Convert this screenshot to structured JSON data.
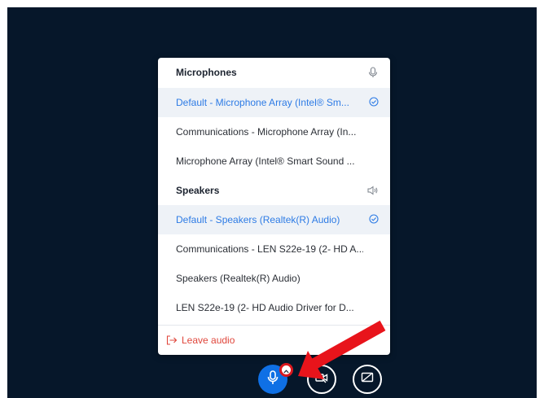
{
  "microphones": {
    "title": "Microphones",
    "header_icon": "microphone-icon",
    "items": [
      {
        "label": "Default - Microphone Array (Intel® Sm...",
        "selected": true
      },
      {
        "label": "Communications - Microphone Array (In...",
        "selected": false
      },
      {
        "label": "Microphone Array (Intel® Smart Sound ...",
        "selected": false
      }
    ]
  },
  "speakers": {
    "title": "Speakers",
    "header_icon": "speaker-icon",
    "items": [
      {
        "label": "Default - Speakers (Realtek(R) Audio)",
        "selected": true
      },
      {
        "label": "Communications - LEN S22e-19 (2- HD A...",
        "selected": false
      },
      {
        "label": "Speakers (Realtek(R) Audio)",
        "selected": false
      },
      {
        "label": "LEN S22e-19 (2- HD Audio Driver for D...",
        "selected": false
      }
    ]
  },
  "leave_audio": {
    "label": "Leave audio",
    "icon": "exit-icon"
  },
  "controls": {
    "mic_button_icon": "microphone-icon",
    "audio_options_icon": "chevron-up-icon",
    "video_button_icon": "video-off-icon",
    "share_button_icon": "screen-share-off-icon"
  },
  "colors": {
    "background": "#06172a",
    "accent": "#2d7be5",
    "selected_row": "#eef2f7",
    "danger": "#e0463b",
    "mic_button": "#0f70e5",
    "annotation_arrow": "#e8141b"
  }
}
